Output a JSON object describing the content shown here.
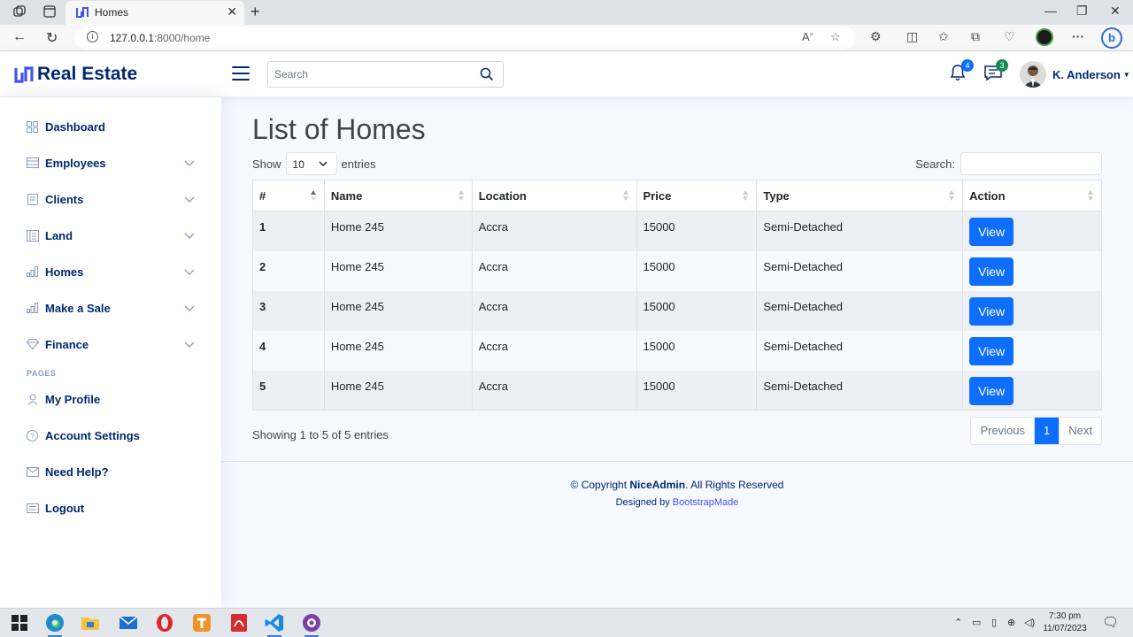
{
  "browser": {
    "tab_title": "Homes",
    "url_host": "127.0.0.1",
    "url_rest": ":8000/home"
  },
  "header": {
    "brand": "Real Estate",
    "search_placeholder": "Search",
    "notifications_count": "4",
    "messages_count": "3",
    "user_name": "K. Anderson"
  },
  "sidebar": {
    "items": [
      {
        "label": "Dashboard",
        "icon": "grid-icon"
      },
      {
        "label": "Employees",
        "icon": "list-icon"
      },
      {
        "label": "Clients",
        "icon": "journal-icon"
      },
      {
        "label": "Land",
        "icon": "layout-icon"
      },
      {
        "label": "Homes",
        "icon": "bar-chart-icon"
      },
      {
        "label": "Make a Sale",
        "icon": "bar-chart-icon"
      },
      {
        "label": "Finance",
        "icon": "gem-icon"
      }
    ],
    "pages_heading": "PAGES",
    "pages": [
      {
        "label": "My Profile",
        "icon": "person-icon"
      },
      {
        "label": "Account Settings",
        "icon": "question-circle-icon"
      },
      {
        "label": "Need Help?",
        "icon": "envelope-icon"
      },
      {
        "label": "Logout",
        "icon": "card-list-icon"
      }
    ]
  },
  "main": {
    "title": "List of Homes",
    "show_label": "Show",
    "entries_value": "10",
    "entries_label": "entries",
    "search_label": "Search:",
    "columns": [
      "#",
      "Name",
      "Location",
      "Price",
      "Type",
      "Action"
    ],
    "rows": [
      {
        "num": "1",
        "name": "Home 245",
        "location": "Accra",
        "price": "15000",
        "type": "Semi-Detached",
        "action": "View"
      },
      {
        "num": "2",
        "name": "Home 245",
        "location": "Accra",
        "price": "15000",
        "type": "Semi-Detached",
        "action": "View"
      },
      {
        "num": "3",
        "name": "Home 245",
        "location": "Accra",
        "price": "15000",
        "type": "Semi-Detached",
        "action": "View"
      },
      {
        "num": "4",
        "name": "Home 245",
        "location": "Accra",
        "price": "15000",
        "type": "Semi-Detached",
        "action": "View"
      },
      {
        "num": "5",
        "name": "Home 245",
        "location": "Accra",
        "price": "15000",
        "type": "Semi-Detached",
        "action": "View"
      }
    ],
    "info": "Showing 1 to 5 of 5 entries",
    "pagination": {
      "previous": "Previous",
      "current": "1",
      "next": "Next"
    }
  },
  "footer": {
    "copy_prefix": "© Copyright ",
    "copy_brand": "NiceAdmin",
    "copy_suffix": ". All Rights Reserved",
    "designed_by": "Designed by ",
    "designer": "BootstrapMade"
  },
  "taskbar": {
    "time": "7:30 pm",
    "date": "11/07/2023"
  },
  "colors": {
    "primary": "#0d6efd",
    "brand": "#012970",
    "page_bg": "#f6f9ff"
  }
}
